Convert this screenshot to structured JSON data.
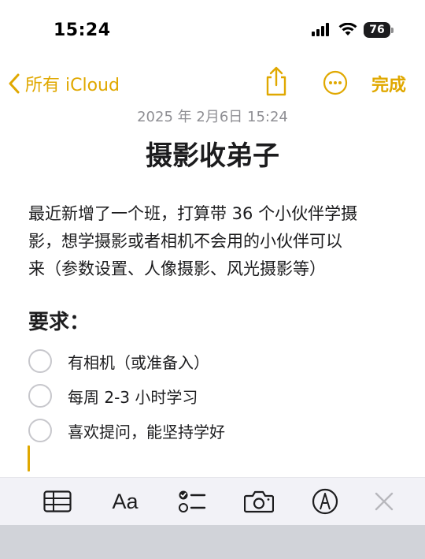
{
  "status_bar": {
    "time": "15:24",
    "battery": "76"
  },
  "nav": {
    "back_label": "所有 iCloud",
    "done_label": "完成"
  },
  "note": {
    "date": "2025 年 2月6日 15:24",
    "title": "摄影收弟子",
    "body_lines": [
      "最近新增了一个班，打算带 36 个小伙伴学摄",
      "影，想学摄影或者相机不会用的小伙伴可以",
      "来（参数设置、人像摄影、风光摄影等）"
    ],
    "requirements_heading": "要求：",
    "checklist": [
      {
        "text": "有相机（或准备入）",
        "checked": false
      },
      {
        "text": "每周 2-3 小时学习",
        "checked": false
      },
      {
        "text": "喜欢提问，能坚持学好",
        "checked": false
      }
    ]
  },
  "toolbar": {
    "format_label": "Aa"
  },
  "colors": {
    "accent": "#e0a800",
    "secondary_text": "#8e8e93",
    "toolbar_bg": "#f2f2f7",
    "keyboard_bg": "#d1d3d9"
  },
  "icons": [
    "cellular-signal-icon",
    "wifi-icon",
    "battery-icon",
    "chevron-left-icon",
    "share-icon",
    "more-icon",
    "table-icon",
    "checklist-icon",
    "camera-icon",
    "markup-icon",
    "close-icon"
  ]
}
